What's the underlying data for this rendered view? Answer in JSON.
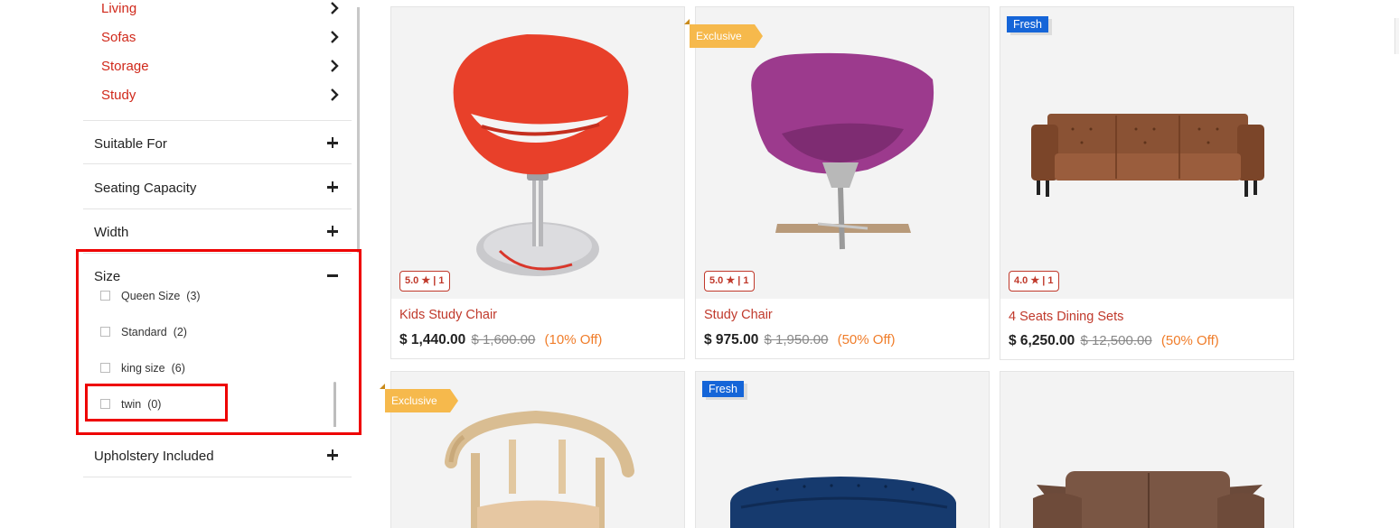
{
  "sidebar": {
    "categories": [
      {
        "label": "Living"
      },
      {
        "label": "Sofas"
      },
      {
        "label": "Storage"
      },
      {
        "label": "Study"
      }
    ],
    "facets": {
      "suitable_for": "Suitable For",
      "seating_capacity": "Seating Capacity",
      "width": "Width",
      "size": "Size",
      "upholstery": "Upholstery Included"
    },
    "size_options": [
      {
        "label": "Queen Size",
        "count": "(3)"
      },
      {
        "label": "Standard",
        "count": "(2)"
      },
      {
        "label": "king size",
        "count": "(6)"
      },
      {
        "label": "twin",
        "count": "(0)"
      }
    ]
  },
  "products": [
    {
      "name": "Kids Study Chair",
      "price": "$ 1,440.00",
      "mrp": "$ 1,600.00",
      "discount": "(10% Off)",
      "rating": "5.0",
      "reviews": "| 1",
      "badge": ""
    },
    {
      "name": "Study Chair",
      "price": "$ 975.00",
      "mrp": "$ 1,950.00",
      "discount": "(50% Off)",
      "rating": "5.0",
      "reviews": "| 1",
      "badge": "Exclusive"
    },
    {
      "name": "4 Seats Dining Sets",
      "price": "$ 6,250.00",
      "mrp": "$ 12,500.00",
      "discount": "(50% Off)",
      "rating": "4.0",
      "reviews": "| 1",
      "badge": "Fresh"
    },
    {
      "badge": "Exclusive"
    },
    {
      "badge": "Fresh"
    },
    {
      "badge": ""
    }
  ],
  "colors": {
    "accent_red": "#d0281a",
    "discount_orange": "#f07d2a",
    "fresh_blue": "#1565d8",
    "exclusive_yellow": "#f6b94c",
    "highlight_red": "#ee0000"
  }
}
